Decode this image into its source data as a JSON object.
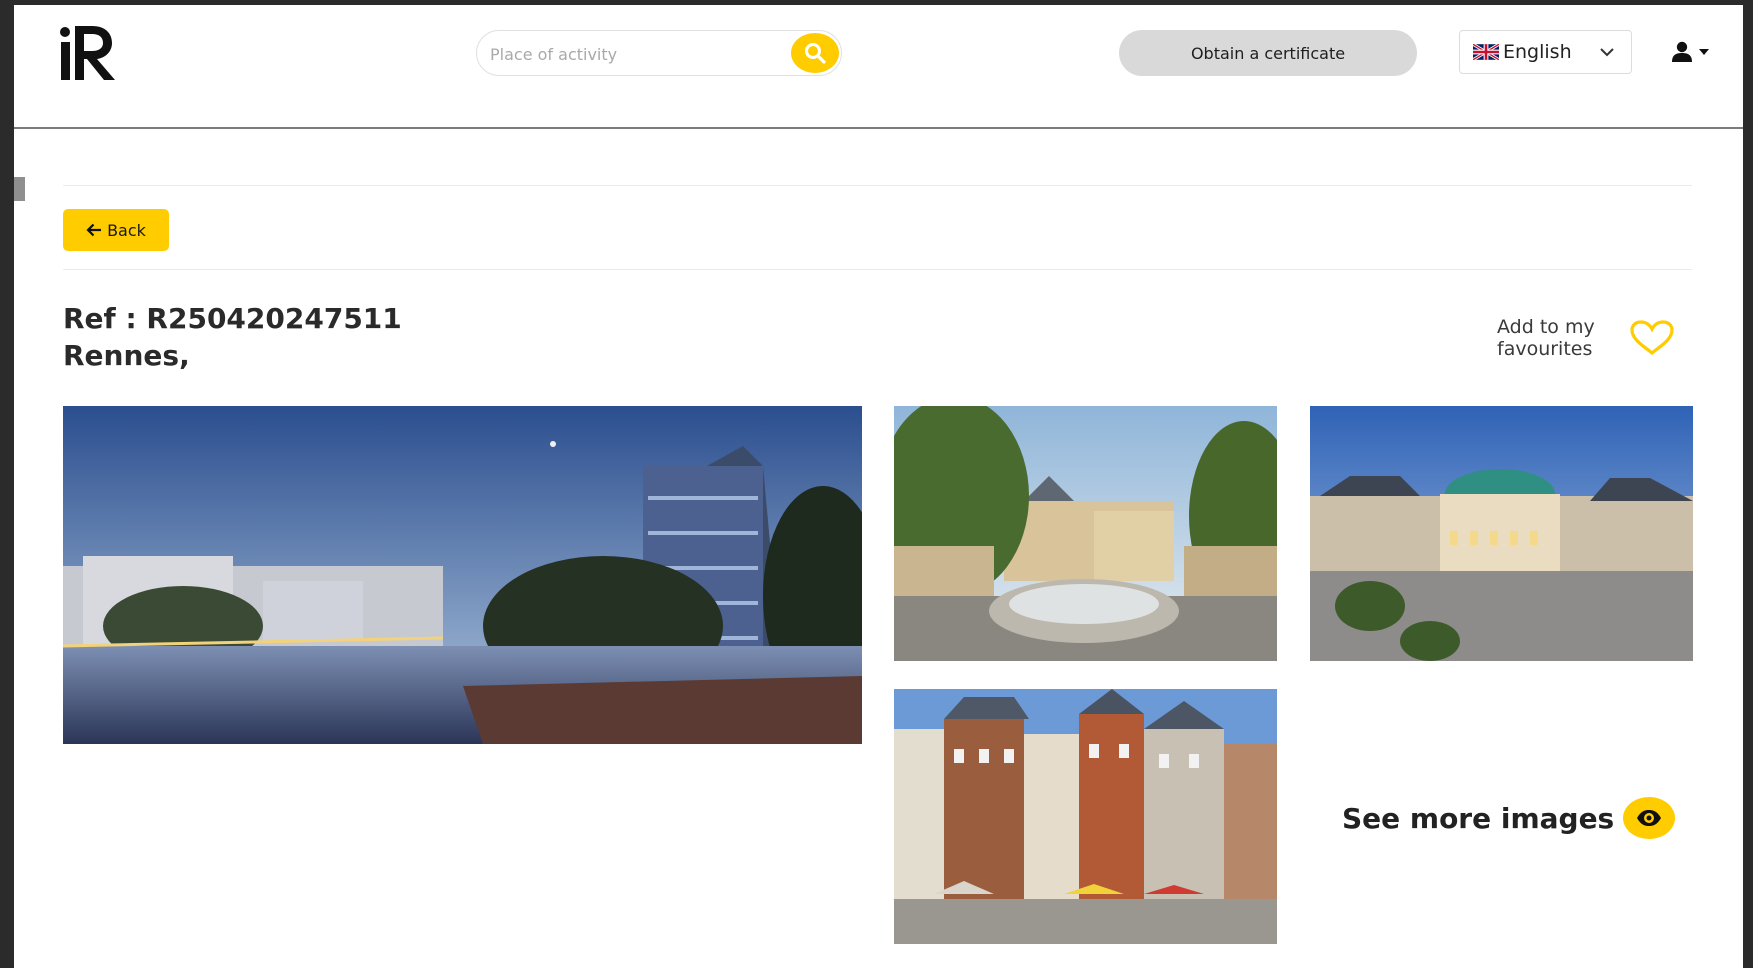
{
  "header": {
    "search_placeholder": "Place of activity",
    "certificate_label": "Obtain a certificate",
    "language": {
      "selected": "English",
      "flag": "uk-flag-icon"
    }
  },
  "main": {
    "back_label": "Back",
    "ref_line": "Ref : R250420247511",
    "city_line": "Rennes,",
    "favourites_label": "Add to my favourites",
    "see_more_label": "See more images"
  },
  "colors": {
    "accent": "#ffcc00",
    "certificate_bg": "#d9d9d9",
    "text": "#222222"
  }
}
